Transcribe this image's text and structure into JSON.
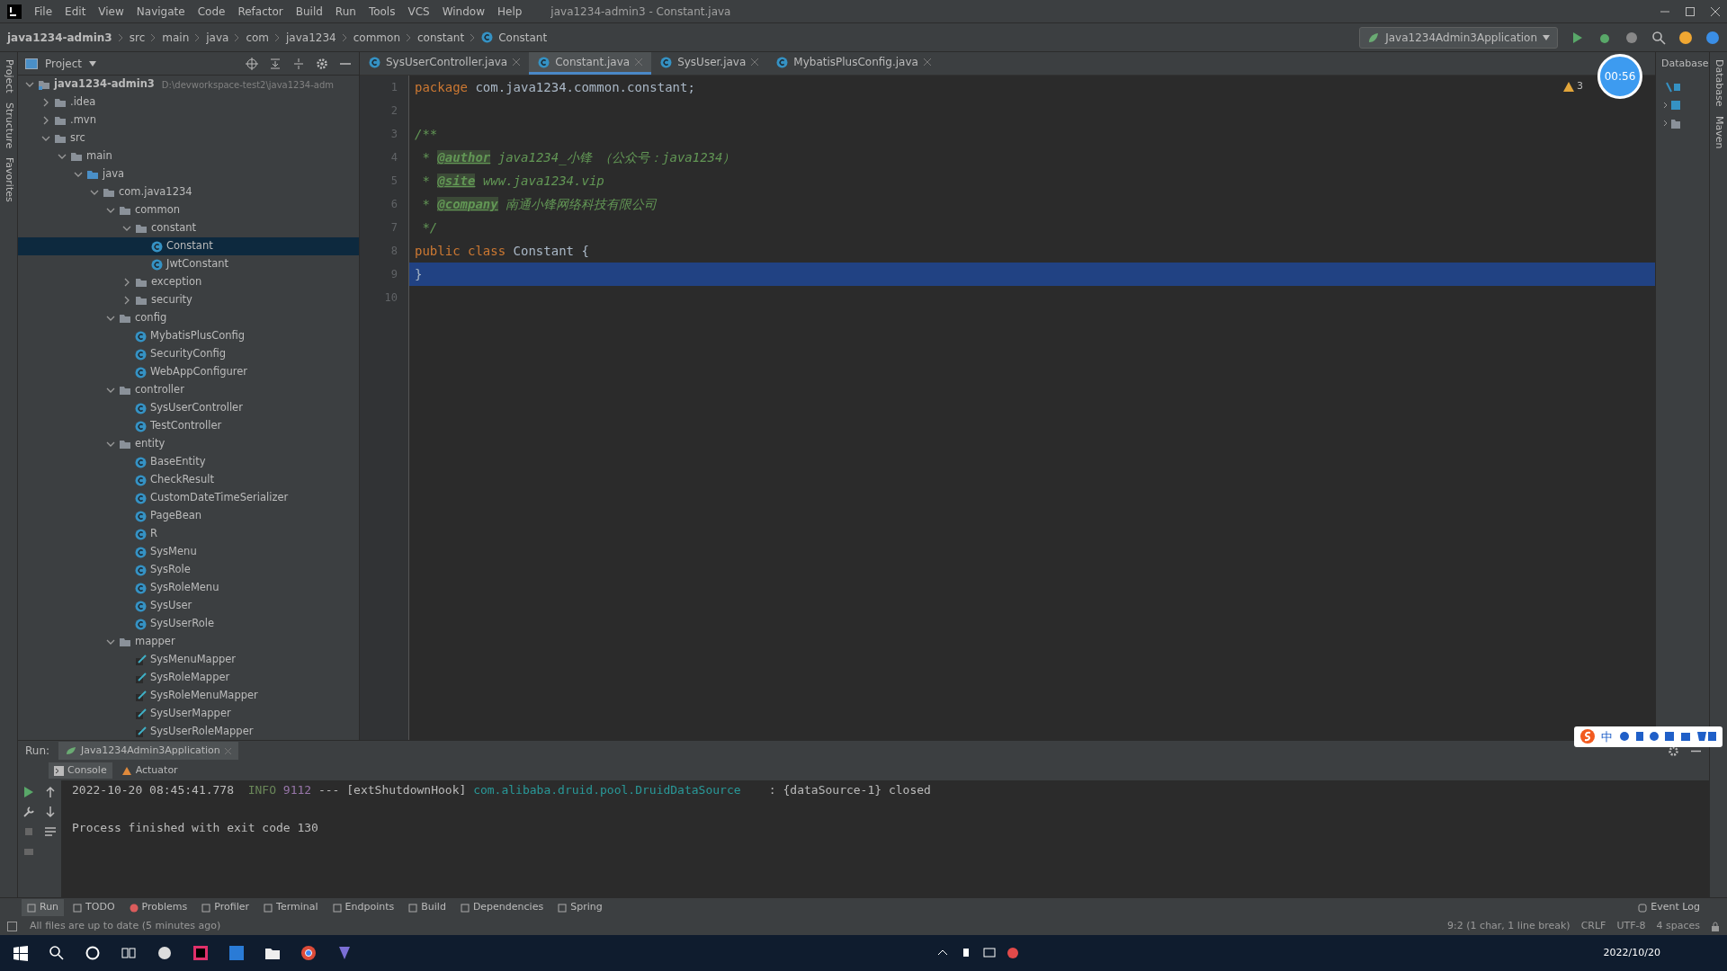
{
  "window": {
    "title": "java1234-admin3 - Constant.java"
  },
  "menu": [
    "File",
    "Edit",
    "View",
    "Navigate",
    "Code",
    "Refactor",
    "Build",
    "Run",
    "Tools",
    "VCS",
    "Window",
    "Help"
  ],
  "breadcrumb": [
    {
      "label": "java1234-admin3",
      "kind": "module"
    },
    {
      "label": "src",
      "kind": "folder"
    },
    {
      "label": "main",
      "kind": "folder"
    },
    {
      "label": "java",
      "kind": "folder"
    },
    {
      "label": "com",
      "kind": "folder"
    },
    {
      "label": "java1234",
      "kind": "folder"
    },
    {
      "label": "common",
      "kind": "folder"
    },
    {
      "label": "constant",
      "kind": "folder"
    },
    {
      "label": "Constant",
      "kind": "class"
    }
  ],
  "run_config": "Java1234Admin3Application",
  "project_panel": {
    "title": "Project",
    "tree": [
      {
        "label": "java1234-admin3",
        "kind": "module",
        "path": "D:\\devworkspace-test2\\java1234-adm",
        "expanded": true,
        "selected": false,
        "children": [
          {
            "label": ".idea",
            "kind": "folder",
            "expanded": false,
            "selected": false
          },
          {
            "label": ".mvn",
            "kind": "folder",
            "expanded": false,
            "selected": false
          },
          {
            "label": "src",
            "kind": "folder",
            "expanded": true,
            "selected": false,
            "children": [
              {
                "label": "main",
                "kind": "folder",
                "expanded": true,
                "selected": false,
                "children": [
                  {
                    "label": "java",
                    "kind": "source",
                    "expanded": true,
                    "selected": false,
                    "children": [
                      {
                        "label": "com.java1234",
                        "kind": "folder",
                        "expanded": true,
                        "selected": false,
                        "children": [
                          {
                            "label": "common",
                            "kind": "folder",
                            "expanded": true,
                            "selected": false,
                            "children": [
                              {
                                "label": "constant",
                                "kind": "folder",
                                "expanded": true,
                                "selected": false,
                                "children": [
                                  {
                                    "label": "Constant",
                                    "kind": "class",
                                    "selected": true
                                  },
                                  {
                                    "label": "JwtConstant",
                                    "kind": "class",
                                    "selected": false
                                  }
                                ]
                              },
                              {
                                "label": "exception",
                                "kind": "folder",
                                "expanded": false,
                                "selected": false
                              },
                              {
                                "label": "security",
                                "kind": "folder",
                                "expanded": false,
                                "selected": false
                              }
                            ]
                          },
                          {
                            "label": "config",
                            "kind": "folder",
                            "expanded": true,
                            "selected": false,
                            "children": [
                              {
                                "label": "MybatisPlusConfig",
                                "kind": "class",
                                "selected": false
                              },
                              {
                                "label": "SecurityConfig",
                                "kind": "class",
                                "selected": false
                              },
                              {
                                "label": "WebAppConfigurer",
                                "kind": "class",
                                "selected": false
                              }
                            ]
                          },
                          {
                            "label": "controller",
                            "kind": "folder",
                            "expanded": true,
                            "selected": false,
                            "children": [
                              {
                                "label": "SysUserController",
                                "kind": "class",
                                "selected": false
                              },
                              {
                                "label": "TestController",
                                "kind": "class",
                                "selected": false
                              }
                            ]
                          },
                          {
                            "label": "entity",
                            "kind": "folder",
                            "expanded": true,
                            "selected": false,
                            "children": [
                              {
                                "label": "BaseEntity",
                                "kind": "class",
                                "selected": false
                              },
                              {
                                "label": "CheckResult",
                                "kind": "class",
                                "selected": false
                              },
                              {
                                "label": "CustomDateTimeSerializer",
                                "kind": "class",
                                "selected": false
                              },
                              {
                                "label": "PageBean",
                                "kind": "class",
                                "selected": false
                              },
                              {
                                "label": "R",
                                "kind": "class",
                                "selected": false
                              },
                              {
                                "label": "SysMenu",
                                "kind": "class",
                                "selected": false
                              },
                              {
                                "label": "SysRole",
                                "kind": "class",
                                "selected": false
                              },
                              {
                                "label": "SysRoleMenu",
                                "kind": "class",
                                "selected": false
                              },
                              {
                                "label": "SysUser",
                                "kind": "class",
                                "selected": false
                              },
                              {
                                "label": "SysUserRole",
                                "kind": "class",
                                "selected": false
                              }
                            ]
                          },
                          {
                            "label": "mapper",
                            "kind": "folder",
                            "expanded": true,
                            "selected": false,
                            "children": [
                              {
                                "label": "SysMenuMapper",
                                "kind": "mapper",
                                "selected": false
                              },
                              {
                                "label": "SysRoleMapper",
                                "kind": "mapper",
                                "selected": false
                              },
                              {
                                "label": "SysRoleMenuMapper",
                                "kind": "mapper",
                                "selected": false
                              },
                              {
                                "label": "SysUserMapper",
                                "kind": "mapper",
                                "selected": false
                              },
                              {
                                "label": "SysUserRoleMapper",
                                "kind": "mapper",
                                "selected": false
                              }
                            ]
                          }
                        ]
                      }
                    ]
                  }
                ]
              }
            ]
          }
        ]
      }
    ]
  },
  "editor_tabs": [
    {
      "label": "SysUserController.java",
      "selected": false
    },
    {
      "label": "Constant.java",
      "selected": true
    },
    {
      "label": "SysUser.java",
      "selected": false
    },
    {
      "label": "MybatisPlusConfig.java",
      "selected": false
    }
  ],
  "editor": {
    "warning_count": "3",
    "lines": [
      {
        "number": "1",
        "selected": false,
        "segments": [
          {
            "kind": "keyword",
            "text": "package "
          },
          {
            "kind": "plain",
            "text": "com.java1234.common.constant;"
          }
        ]
      },
      {
        "number": "2",
        "selected": false
      },
      {
        "number": "3",
        "selected": false,
        "segments": [
          {
            "kind": "comment",
            "text": "/**"
          }
        ]
      },
      {
        "number": "4",
        "selected": false,
        "segments": [
          {
            "kind": "comment",
            "text": " * "
          },
          {
            "kind": "tag",
            "text": "@author"
          },
          {
            "kind": "comment",
            "text": " java1234_小锋 （公众号：java1234）"
          }
        ]
      },
      {
        "number": "5",
        "selected": false,
        "segments": [
          {
            "kind": "comment",
            "text": " * "
          },
          {
            "kind": "tag",
            "text": "@site"
          },
          {
            "kind": "comment",
            "text": " www.java1234.vip"
          }
        ]
      },
      {
        "number": "6",
        "selected": false,
        "segments": [
          {
            "kind": "comment",
            "text": " * "
          },
          {
            "kind": "tag",
            "text": "@company"
          },
          {
            "kind": "comment",
            "text": " 南通小锋网络科技有限公司"
          }
        ]
      },
      {
        "number": "7",
        "selected": false,
        "segments": [
          {
            "kind": "comment",
            "text": " */"
          }
        ]
      },
      {
        "number": "8",
        "selected": false,
        "segments": [
          {
            "kind": "keyword",
            "text": "public class "
          },
          {
            "kind": "plain",
            "text": "Constant {"
          }
        ]
      },
      {
        "number": "9",
        "selected": true,
        "segments": [
          {
            "kind": "plain",
            "text": "}"
          }
        ]
      },
      {
        "number": "10",
        "selected": false
      }
    ]
  },
  "database_panel": {
    "title": "Database"
  },
  "recording_timer": "00:56",
  "ime_toolbar": {
    "label": "中"
  },
  "left_stripe": [
    "Project",
    "Structure",
    "Favorites"
  ],
  "right_stripe": [
    "Database",
    "Maven"
  ],
  "run_panel": {
    "label": "Run:",
    "tab": "Java1234Admin3Application",
    "subtabs": [
      {
        "label": "Console",
        "selected": true
      },
      {
        "label": "Actuator",
        "selected": false
      }
    ],
    "console": [
      [
        {
          "kind": "plain",
          "text": "2022-10-20 08:45:41.778  "
        },
        {
          "kind": "level",
          "text": "INFO"
        },
        {
          "kind": "pid",
          "text": " 9112"
        },
        {
          "kind": "plain",
          "text": " --- [extShutdownHook] "
        },
        {
          "kind": "logger",
          "text": "com.alibaba.druid.pool.DruidDataSource"
        },
        {
          "kind": "plain",
          "text": "    : {dataSource-1} closed"
        }
      ],
      [
        {
          "kind": "plain",
          "text": "Process finished with exit code 130"
        }
      ]
    ]
  },
  "tool_tabs": [
    {
      "label": "Run",
      "selected": true
    },
    {
      "label": "TODO",
      "selected": false
    },
    {
      "label": "Problems",
      "selected": false
    },
    {
      "label": "Profiler",
      "selected": false
    },
    {
      "label": "Terminal",
      "selected": false
    },
    {
      "label": "Endpoints",
      "selected": false
    },
    {
      "label": "Build",
      "selected": false
    },
    {
      "label": "Dependencies",
      "selected": false
    },
    {
      "label": "Spring",
      "selected": false
    }
  ],
  "event_log": "Event Log",
  "status_bar": {
    "message": "All files are up to date (5 minutes ago)",
    "items": [
      "9:2 (1 char, 1 line break)",
      "CRLF",
      "UTF-8",
      "4 spaces"
    ]
  },
  "taskbar": {
    "date": "2022/10/20"
  }
}
